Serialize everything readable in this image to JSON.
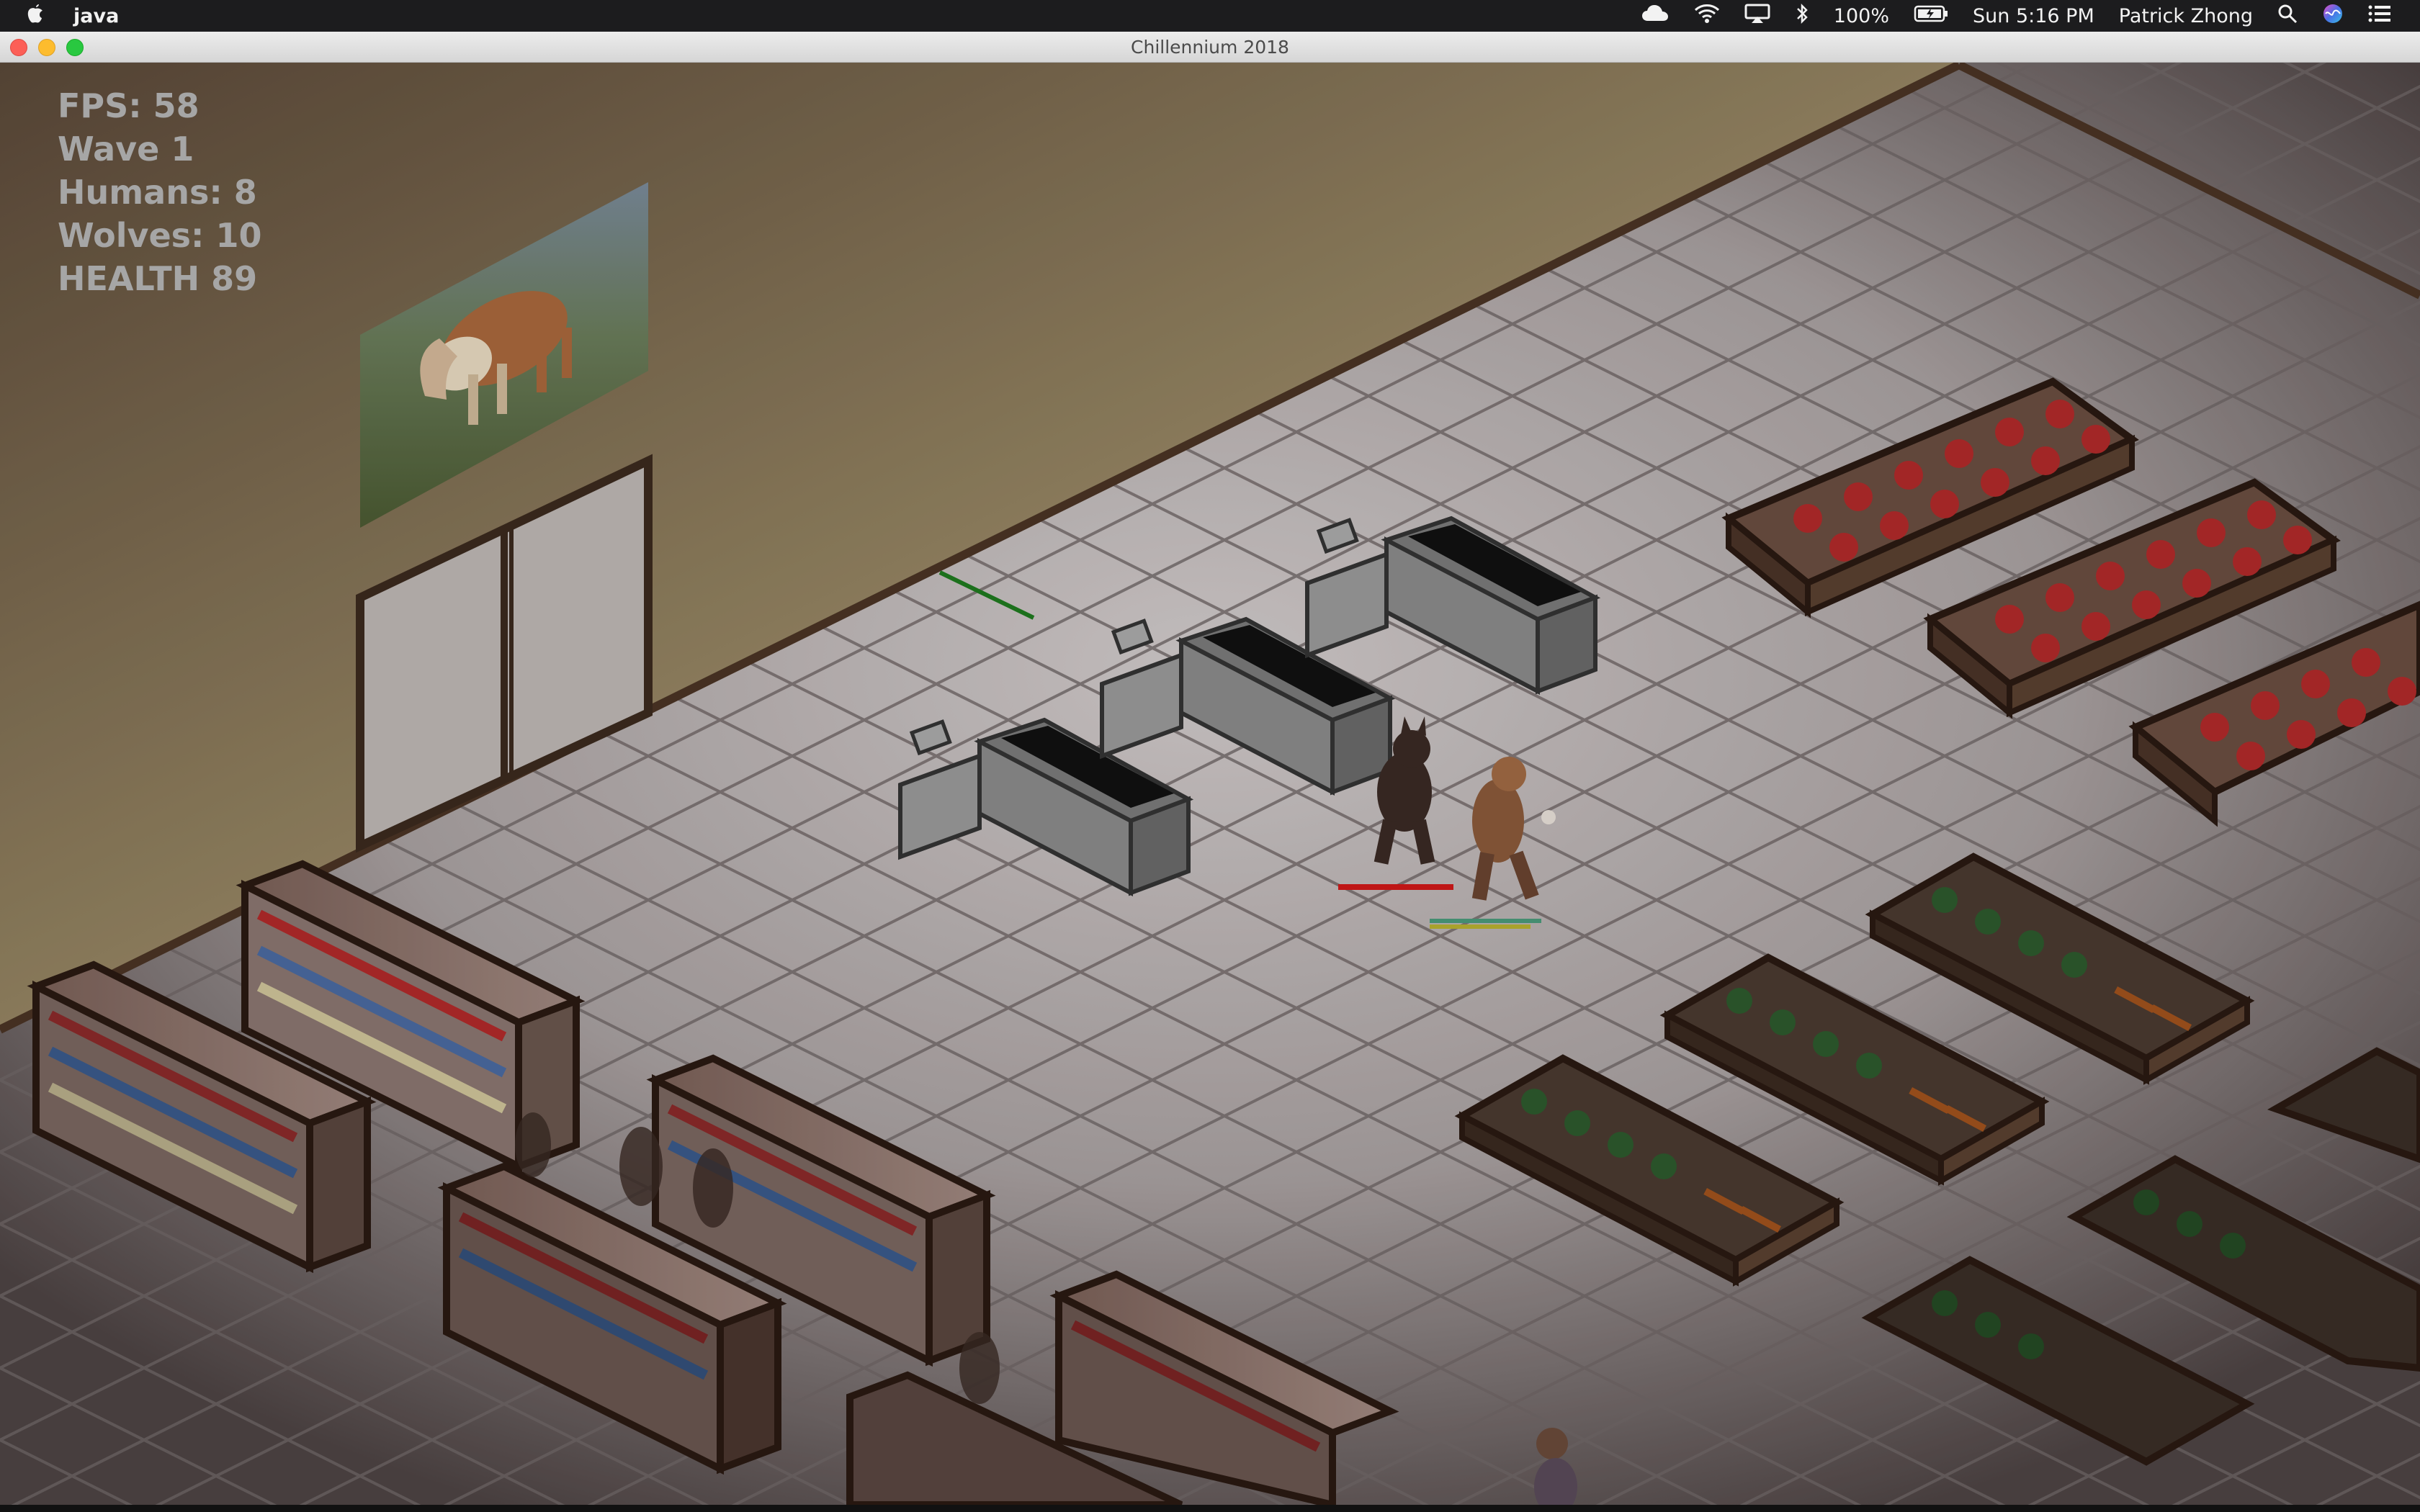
{
  "menubar": {
    "app_name": "java",
    "battery": "100%",
    "clock": "Sun 5:16 PM",
    "user": "Patrick Zhong"
  },
  "window": {
    "title": "Chillennium 2018"
  },
  "hud": {
    "fps": "FPS: 58",
    "wave": "Wave 1",
    "humans": "Humans: 8",
    "wolves": "Wolves: 10",
    "health": "HEALTH 89"
  },
  "colors": {
    "hud_text": "#a6a6a6",
    "floor": "#a89e9e",
    "wall": "#6e5a4a",
    "enemy_health_bar": "#d01818",
    "player_bar": "#4a9a7a"
  },
  "icons": [
    "apple-icon",
    "creative-cloud-icon",
    "wifi-icon",
    "airplay-icon",
    "bluetooth-icon",
    "battery-icon",
    "search-icon",
    "siri-icon",
    "notification-center-icon"
  ]
}
